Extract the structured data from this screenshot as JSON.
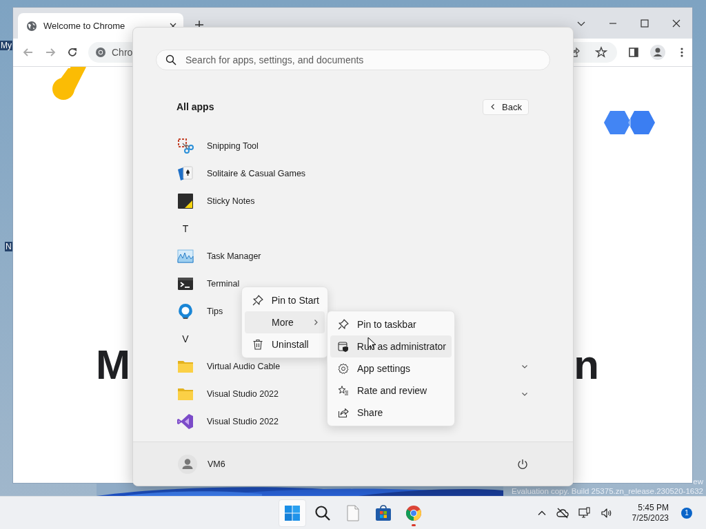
{
  "desktop": {
    "icon_labels": [
      {
        "label": "My"
      },
      {
        "label": "N"
      }
    ],
    "watermark_lines": [
      "ew",
      "Evaluation copy. Build 25375.zn_release.230520-1632"
    ]
  },
  "browser": {
    "tabs": [
      {
        "title": "Welcome to Chrome",
        "selected": true
      }
    ],
    "address_text": "Chro",
    "page": {
      "heading_start": "M",
      "heading_end": "n"
    }
  },
  "start_menu": {
    "search": {
      "placeholder": "Search for apps, settings, and documents"
    },
    "section_title": "All apps",
    "back_button": "Back",
    "apps": [
      {
        "kind": "snipping",
        "label": "Snipping Tool"
      },
      {
        "kind": "solitaire",
        "label": "Solitaire & Casual Games"
      },
      {
        "kind": "sticky",
        "label": "Sticky Notes"
      },
      {
        "kind": "letter",
        "label": "T"
      },
      {
        "kind": "taskmgr",
        "label": "Task Manager"
      },
      {
        "kind": "terminal",
        "label": "Terminal"
      },
      {
        "kind": "tips",
        "label": "Tips"
      },
      {
        "kind": "letter",
        "label": "V"
      },
      {
        "kind": "folder",
        "label": "Virtual Audio Cable",
        "expanded": false
      },
      {
        "kind": "folder",
        "label": "Visual Studio 2022",
        "expanded": false
      },
      {
        "kind": "vs",
        "label": "Visual Studio 2022"
      }
    ],
    "user": "VM6"
  },
  "context_menu": {
    "items": [
      {
        "kind": "pin",
        "label": "Pin to Start",
        "selected": false
      },
      {
        "kind": "submenu",
        "label": "More",
        "selected": true
      },
      {
        "kind": "trash",
        "label": "Uninstall",
        "selected": false
      }
    ]
  },
  "submenu": {
    "items": [
      {
        "kind": "pin",
        "label": "Pin to taskbar",
        "selected": false
      },
      {
        "kind": "admin",
        "label": "Run as administrator",
        "selected": true
      },
      {
        "kind": "settings",
        "label": "App settings",
        "selected": false
      },
      {
        "kind": "rate",
        "label": "Rate and review",
        "selected": false
      },
      {
        "kind": "share",
        "label": "Share",
        "selected": false
      }
    ]
  },
  "taskbar": {
    "apps": [
      {
        "kind": "start",
        "selected": true,
        "running": false
      },
      {
        "kind": "search",
        "selected": false,
        "running": false
      },
      {
        "kind": "file",
        "selected": false,
        "running": false
      },
      {
        "kind": "store",
        "selected": false,
        "running": false
      },
      {
        "kind": "chrome",
        "selected": false,
        "running": true
      }
    ],
    "time": "5:45 PM",
    "date": "7/25/2023",
    "notification_count": "1"
  }
}
